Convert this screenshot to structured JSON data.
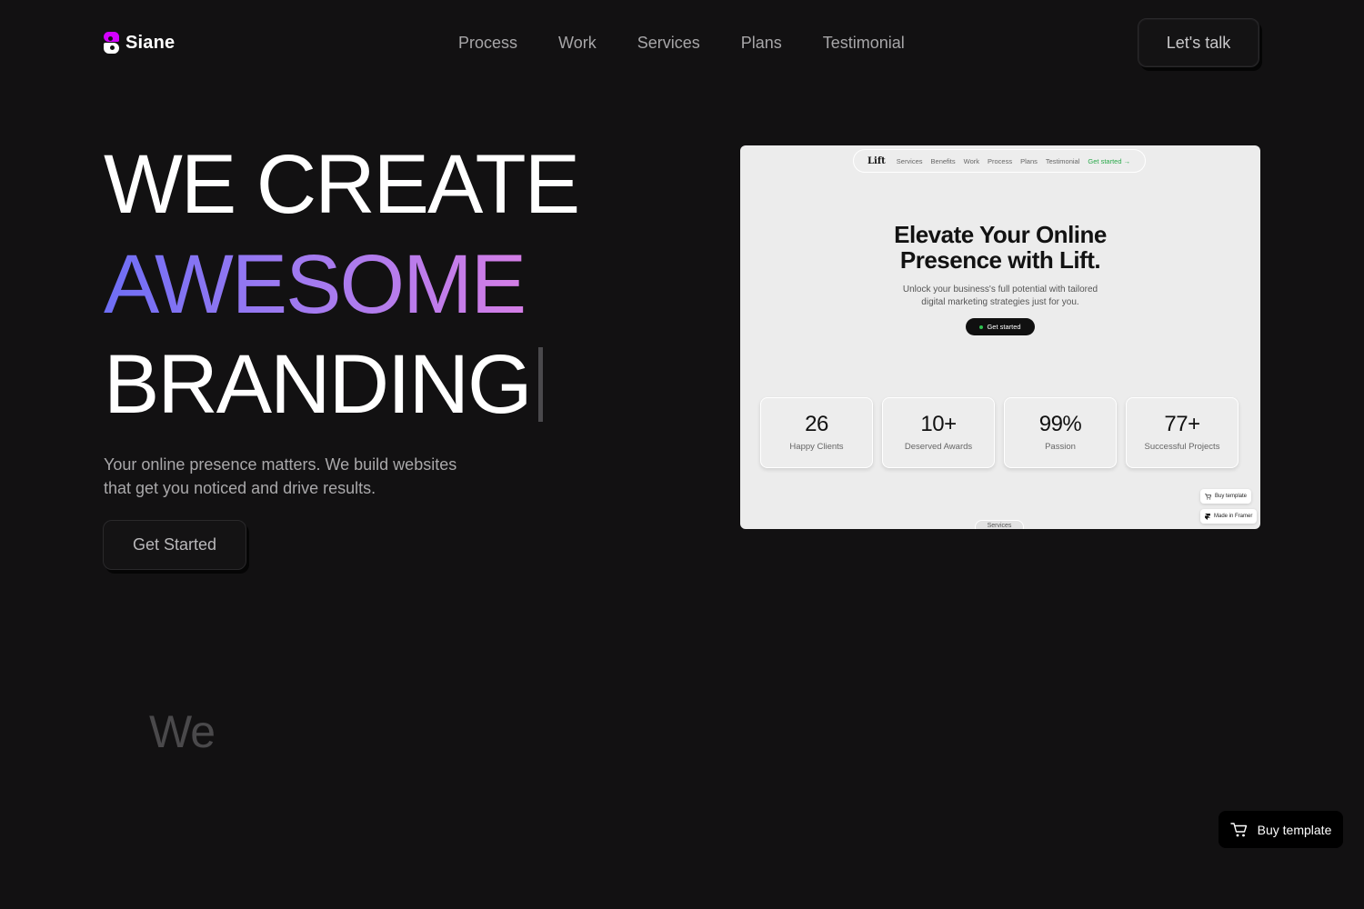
{
  "header": {
    "brand": "Siane",
    "nav": [
      "Process",
      "Work",
      "Services",
      "Plans",
      "Testimonial"
    ],
    "cta_label": "Let's talk"
  },
  "hero": {
    "line1": "WE CREATE",
    "line2": "AWESOME",
    "line3": "BRANDING",
    "subtitle": "Your online presence matters. We build websites that get you noticed and drive results.",
    "button_label": "Get Started",
    "gradient_colors": [
      "#6e6ef5",
      "#9f7af0",
      "#d47ee6"
    ]
  },
  "preview": {
    "logo": "Lift",
    "nav": [
      "Services",
      "Benefits",
      "Work",
      "Process",
      "Plans",
      "Testimonial"
    ],
    "nav_cta": "Get started →",
    "title_line1": "Elevate Your Online",
    "title_line2": "Presence with Lift.",
    "description_line1": "Unlock your business's full potential with tailored",
    "description_line2": "digital marketing strategies just for you.",
    "button_label": "Get started",
    "stats": [
      {
        "value": "26",
        "label": "Happy Clients"
      },
      {
        "value": "10+",
        "label": "Deserved Awards"
      },
      {
        "value": "99%",
        "label": "Passion"
      },
      {
        "value": "77+",
        "label": "Successful Projects"
      }
    ],
    "badge_buy": "Buy template",
    "badge_framer": "Made in Framer",
    "peek_label": "Services"
  },
  "section": {
    "partial_heading": "We"
  },
  "floating": {
    "buy_label": "Buy template",
    "icon": "cart-icon"
  }
}
